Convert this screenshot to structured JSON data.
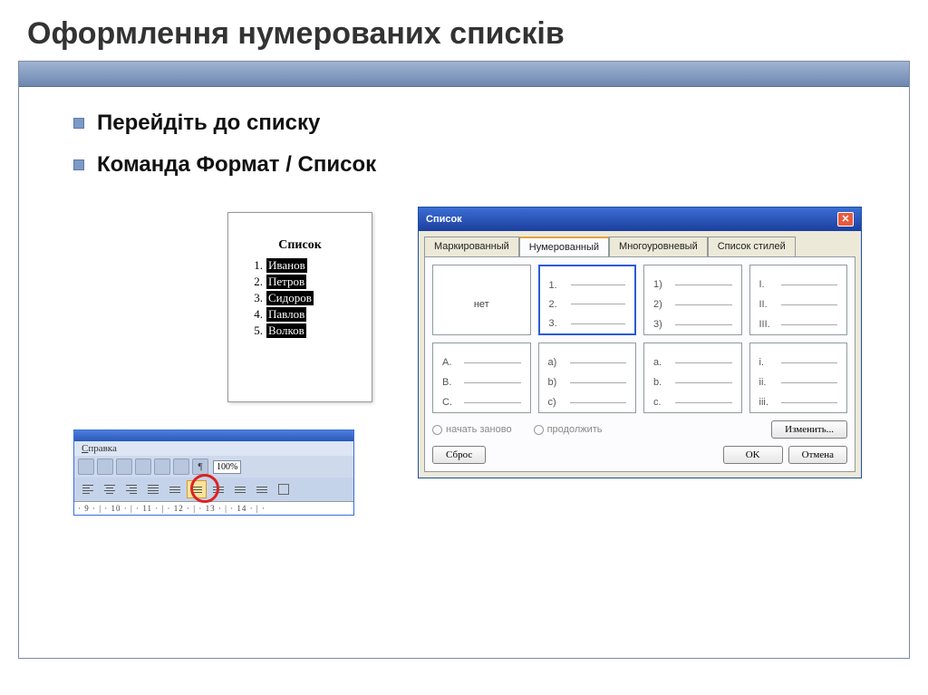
{
  "title": "Оформлення нумерованих списків",
  "bullets": [
    "Перейдіть до списку",
    "Команда Формат / Список"
  ],
  "doc": {
    "heading": "Список",
    "items": [
      "Иванов",
      "Петров",
      "Сидоров",
      "Павлов",
      "Волков"
    ]
  },
  "dialog": {
    "title": "Список",
    "tabs": [
      "Маркированный",
      "Нумерованный",
      "Многоуровневый",
      "Список стилей"
    ],
    "active_tab": 1,
    "none_label": "нет",
    "cells": [
      [
        "1.",
        "2.",
        "3."
      ],
      [
        "1)",
        "2)",
        "3)"
      ],
      [
        "I.",
        "II.",
        "III."
      ],
      [
        "A.",
        "B.",
        "C."
      ],
      [
        "a)",
        "b)",
        "c)"
      ],
      [
        "a.",
        "b.",
        "c."
      ],
      [
        "i.",
        "ii.",
        "iii."
      ]
    ],
    "radio_restart": "начать заново",
    "radio_continue": "продолжить",
    "btn_change": "Изменить...",
    "btn_reset": "Сброс",
    "btn_ok": "OK",
    "btn_cancel": "Отмена"
  },
  "toolbar": {
    "menu": "Справка",
    "zoom": "100%",
    "ruler": "· 9 · | · 10 · | · 11 · | · 12 · | · 13 · | · 14 · | ·"
  }
}
